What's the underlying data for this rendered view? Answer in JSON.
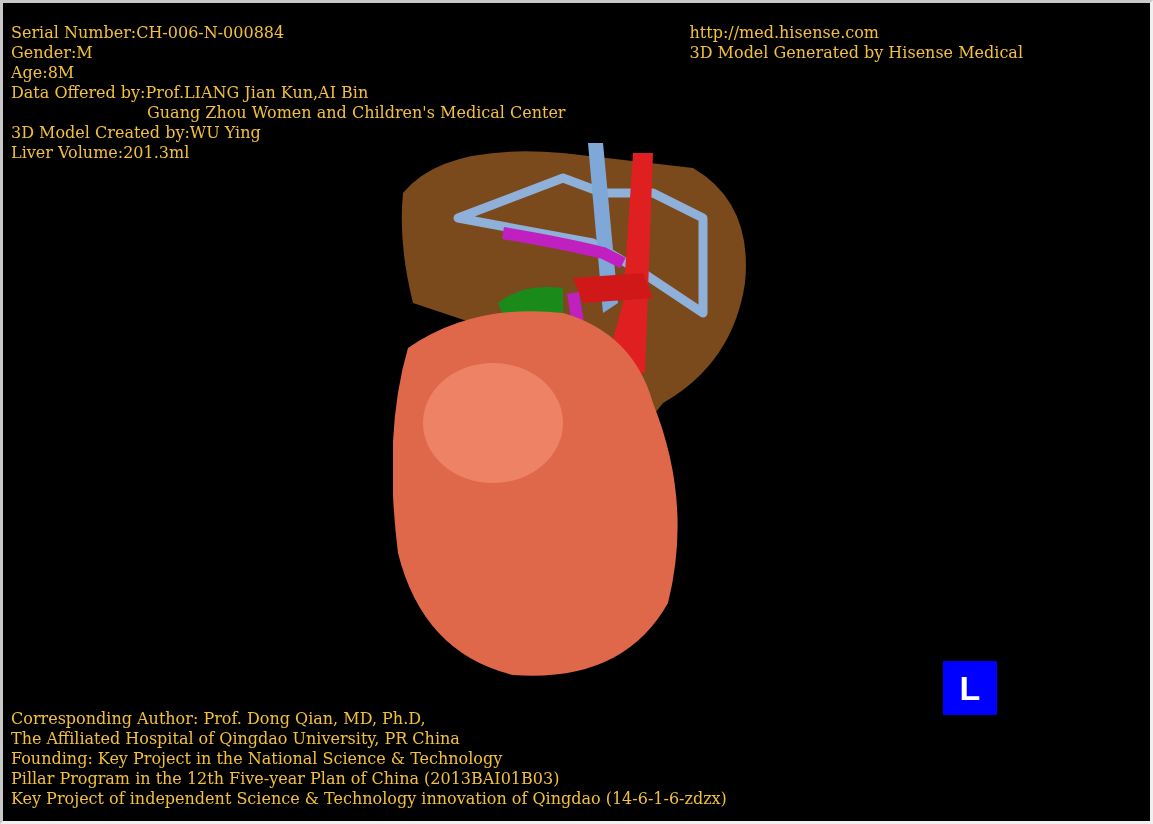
{
  "info_left": [
    {
      "kind": "line",
      "text": "Serial Number:CH-006-N-000884"
    },
    {
      "kind": "line",
      "text": "Gender:M"
    },
    {
      "kind": "line",
      "text": "Age:8M"
    },
    {
      "kind": "line",
      "text": "Data Offered by:Prof.LIANG Jian Kun,AI Bin"
    },
    {
      "kind": "indented",
      "text": "Guang Zhou Women and Children's Medical Center"
    },
    {
      "kind": "line",
      "text": "3D Model Created by:WU Ying"
    },
    {
      "kind": "line",
      "text": "Liver Volume:201.3ml"
    }
  ],
  "info_right": [
    {
      "text": "http://med.hisense.com"
    },
    {
      "text": "3D Model Generated by Hisense Medical"
    }
  ],
  "footer": [
    {
      "text": "Corresponding Author: Prof. Dong Qian, MD, Ph.D,"
    },
    {
      "text": "The Affiliated Hospital of Qingdao University, PR China"
    },
    {
      "text": "Founding: Key Project in the National Science & Technology"
    },
    {
      "text": "Pillar Program in the 12th Five-year Plan of China (2013BAI01B03)"
    },
    {
      "text": "Key Project of independent Science & Technology innovation of Qingdao (14-6-1-6-zdzx)"
    }
  ],
  "orientation_marker": {
    "label": "L"
  }
}
